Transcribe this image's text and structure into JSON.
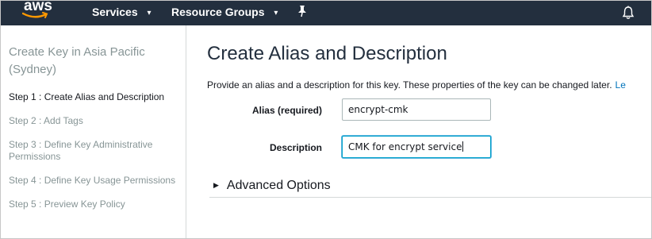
{
  "topnav": {
    "logo_text": "aws",
    "services_label": "Services",
    "resource_groups_label": "Resource Groups",
    "caret": "▾"
  },
  "sidebar": {
    "title": "Create Key in Asia Pacific (Sydney)",
    "steps": [
      {
        "label": "Step 1 : Create Alias and Description",
        "active": true
      },
      {
        "label": "Step 2 : Add Tags",
        "active": false
      },
      {
        "label": "Step 3 : Define Key Administrative Permissions",
        "active": false
      },
      {
        "label": "Step 4 : Define Key Usage Permissions",
        "active": false
      },
      {
        "label": "Step 5 : Preview Key Policy",
        "active": false
      }
    ]
  },
  "main": {
    "title": "Create Alias and Description",
    "description": "Provide an alias and a description for this key. These properties of the key can be changed later.",
    "learn_more_fragment": "Le",
    "alias_label": "Alias (required)",
    "alias_value": "encrypt-cmk",
    "description_label": "Description",
    "description_value": "CMK for encrypt service",
    "advanced_label": "Advanced Options"
  },
  "colors": {
    "nav_bg": "#232f3e",
    "logo_smile": "#ff9900",
    "link": "#0073bb",
    "focus": "#00a1c9"
  },
  "icons": [
    "pin-icon",
    "bell-icon",
    "caret-down-icon",
    "expand-triangle-icon"
  ]
}
